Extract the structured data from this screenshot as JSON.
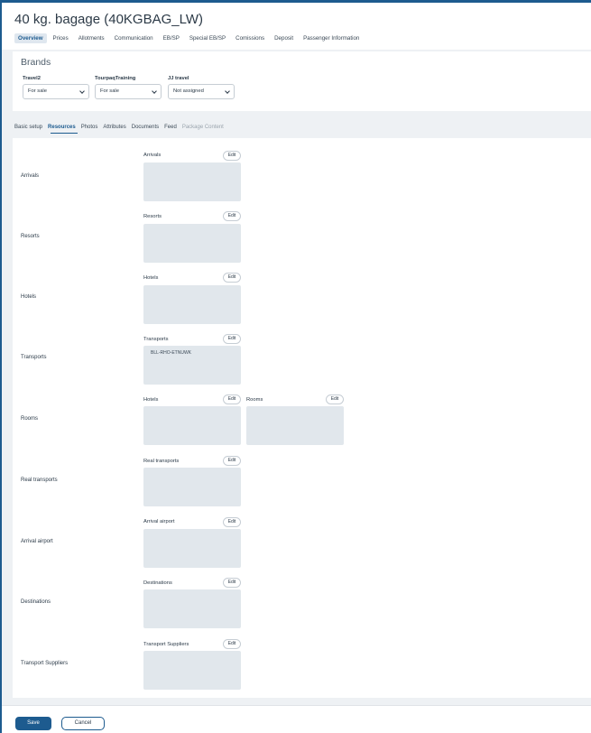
{
  "page": {
    "title": "40 kg. bagage (40KGBAG_LW)"
  },
  "tabs_top": [
    "Overview",
    "Prices",
    "Allotments",
    "Communication",
    "EB/SP",
    "Special EB/SP",
    "Comissions",
    "Deposit",
    "Passenger Information"
  ],
  "brands": {
    "title": "Brands",
    "items": [
      {
        "label": "Travel2",
        "value": "For sale"
      },
      {
        "label": "TourpaqTraining",
        "value": "For sale"
      },
      {
        "label": "JJ travel",
        "value": "Not assigned"
      }
    ]
  },
  "tabs_sub": [
    "Basic setup",
    "Resources",
    "Photos",
    "Attributes",
    "Documents",
    "Feed",
    "Package Content"
  ],
  "resources": {
    "edit_label": "Edit",
    "rows": [
      {
        "label": "Arrivals",
        "box": "Arrivals"
      },
      {
        "label": "Resorts",
        "box": "Resorts"
      },
      {
        "label": "Hotels",
        "box": "Hotels"
      },
      {
        "label": "Transports",
        "box": "Transports",
        "item": "BLL-RHO-ETNUWK"
      },
      {
        "label": "Rooms",
        "box": "Hotels",
        "box2": "Rooms"
      },
      {
        "label": "Real transports",
        "box": "Real transports"
      },
      {
        "label": "Arrival airport",
        "box": "Arrival airport"
      },
      {
        "label": "Destinations",
        "box": "Destinations"
      },
      {
        "label": "Transport Suppliers",
        "box": "Transport Suppliers"
      }
    ]
  },
  "footer": {
    "save": "Save",
    "cancel": "Cancel"
  },
  "colors": {
    "accent": "#1d5b8f",
    "box": "#e1e7ec",
    "page_bg": "#eef1f4"
  }
}
